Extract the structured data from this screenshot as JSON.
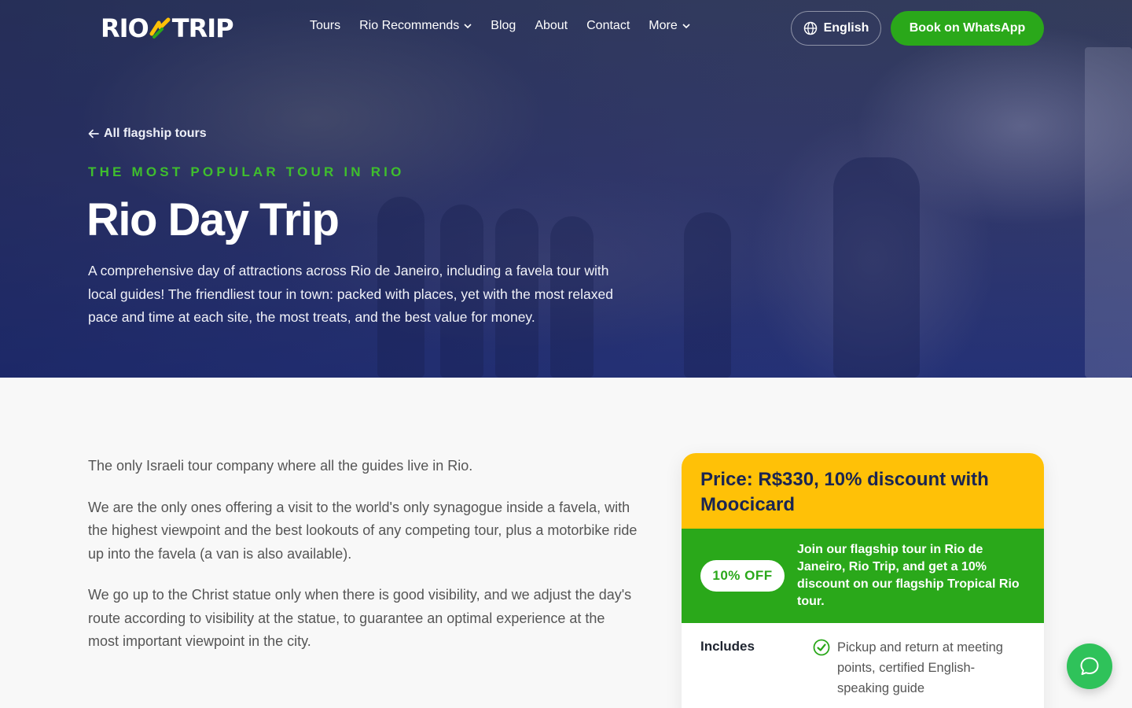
{
  "brand": {
    "logo_left": "RIO",
    "logo_right": "TRIP"
  },
  "nav": {
    "items": [
      {
        "label": "Tours"
      },
      {
        "label": "Rio Recommends",
        "dropdown": true
      },
      {
        "label": "Blog"
      },
      {
        "label": "About"
      },
      {
        "label": "Contact"
      },
      {
        "label": "More",
        "dropdown": true
      }
    ],
    "language": "English",
    "cta": "Book on WhatsApp"
  },
  "hero": {
    "back_link": "All flagship tours",
    "eyebrow": "THE MOST POPULAR TOUR IN RIO",
    "title": "Rio Day Trip",
    "description": "A comprehensive day of attractions across Rio de Janeiro, including a favela tour with local guides! The friendliest tour in town: packed with places, yet with the most relaxed pace and time at each site, the most treats, and the best value for money."
  },
  "content": {
    "paragraphs": [
      "The only Israeli tour company where all the guides live in Rio.",
      "We are the only ones offering a visit to the world's only synagogue inside a favela, with the highest viewpoint and the best lookouts of any competing tour, plus a motorbike ride up into the favela (a van is also available).",
      "We go up to the Christ statue only when there is good visibility, and we adjust the day's route according to visibility at the statue, to guarantee an optimal experience at the most important viewpoint in the city."
    ]
  },
  "price_card": {
    "title": "Price: R$330, 10% discount with Moocicard",
    "promo_badge": "10% OFF",
    "promo_text": "Join our flagship tour in Rio de Janeiro, Rio Trip, and get a 10% discount on our flagship Tropical Rio tour.",
    "includes_label": "Includes",
    "includes_item": "Pickup and return at meeting points, certified English-speaking guide"
  },
  "colors": {
    "accent_green": "#2aa81a",
    "eyebrow_green": "#3fbf2d",
    "price_yellow": "#ffc107",
    "navy": "#1a2552",
    "chat_green": "#2fc25a"
  },
  "icons": [
    "arrow-left-icon",
    "chevron-down-icon",
    "globe-icon",
    "check-circle-icon",
    "chat-bubble-icon"
  ]
}
